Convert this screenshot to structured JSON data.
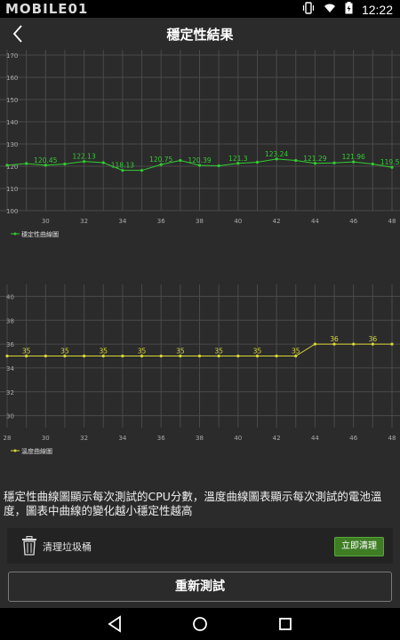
{
  "status_bar": {
    "brand": "MOBILE01",
    "time": "12:22",
    "icons": [
      "vibrate-icon",
      "wifi-icon",
      "battery-icon"
    ]
  },
  "header": {
    "title": "穩定性結果",
    "back_icon": "back-arrow-icon"
  },
  "charts": {
    "stability": {
      "type": "line",
      "color": "#33cc33",
      "legend": "穩定性曲線圖",
      "ylim": [
        100,
        170
      ],
      "yticks": [
        100,
        110,
        120,
        130,
        140,
        150,
        160,
        170
      ],
      "xlim": [
        28,
        48
      ],
      "xticks": [
        30,
        32,
        34,
        36,
        38,
        40,
        42,
        44,
        46,
        48
      ],
      "x": [
        28,
        29,
        30,
        31,
        32,
        33,
        34,
        35,
        36,
        37,
        38,
        39,
        40,
        41,
        42,
        43,
        44,
        45,
        46,
        47,
        48
      ],
      "y": [
        120.45,
        121.2,
        120.45,
        121.0,
        122.13,
        121.6,
        118.13,
        118.13,
        120.75,
        122.6,
        120.39,
        120.2,
        121.3,
        121.8,
        123.24,
        122.6,
        121.29,
        121.5,
        121.96,
        121.0,
        119.52
      ],
      "labels": [
        {
          "x": 30,
          "y": 120.45,
          "text": "120.45"
        },
        {
          "x": 32,
          "y": 122.13,
          "text": "122.13"
        },
        {
          "x": 34,
          "y": 118.13,
          "text": "118.13"
        },
        {
          "x": 36,
          "y": 120.75,
          "text": "120.75"
        },
        {
          "x": 38,
          "y": 120.39,
          "text": "120.39"
        },
        {
          "x": 40,
          "y": 121.3,
          "text": "121.3"
        },
        {
          "x": 42,
          "y": 123.24,
          "text": "123.24"
        },
        {
          "x": 44,
          "y": 121.29,
          "text": "121.29"
        },
        {
          "x": 46,
          "y": 121.96,
          "text": "121.96"
        },
        {
          "x": 48,
          "y": 119.52,
          "text": "119.52"
        }
      ]
    },
    "temperature": {
      "type": "line",
      "color": "#d8d83a",
      "legend": "溫度曲線圖",
      "ylim": [
        29,
        41
      ],
      "yticks": [
        30,
        32,
        34,
        36,
        38,
        40
      ],
      "xlim": [
        28,
        48
      ],
      "xticks": [
        28,
        30,
        32,
        34,
        36,
        38,
        40,
        42,
        44,
        46,
        48
      ],
      "x": [
        28,
        29,
        30,
        31,
        32,
        33,
        34,
        35,
        36,
        37,
        38,
        39,
        40,
        41,
        42,
        43,
        44,
        45,
        46,
        47,
        48
      ],
      "y": [
        35,
        35,
        35,
        35,
        35,
        35,
        35,
        35,
        35,
        35,
        35,
        35,
        35,
        35,
        35,
        35,
        36,
        36,
        36,
        36,
        36
      ],
      "labels": [
        {
          "x": 29,
          "y": 35,
          "text": "35"
        },
        {
          "x": 31,
          "y": 35,
          "text": "35"
        },
        {
          "x": 33,
          "y": 35,
          "text": "35"
        },
        {
          "x": 35,
          "y": 35,
          "text": "35"
        },
        {
          "x": 37,
          "y": 35,
          "text": "35"
        },
        {
          "x": 39,
          "y": 35,
          "text": "35"
        },
        {
          "x": 41,
          "y": 35,
          "text": "35"
        },
        {
          "x": 43,
          "y": 35,
          "text": "35"
        },
        {
          "x": 45,
          "y": 36,
          "text": "36"
        },
        {
          "x": 47,
          "y": 36,
          "text": "36"
        }
      ]
    }
  },
  "description": "穩定性曲線圖顯示每次測試的CPU分數，溫度曲線圖表顯示每次測試的電池溫度，圖表中曲線的變化越小穩定性越高",
  "cleaner": {
    "label": "清理垃圾桶",
    "button": "立即清理",
    "icon": "trash-icon"
  },
  "retest_button": "重新測試",
  "nav": [
    "back-triangle-icon",
    "home-circle-icon",
    "recents-square-icon"
  ]
}
